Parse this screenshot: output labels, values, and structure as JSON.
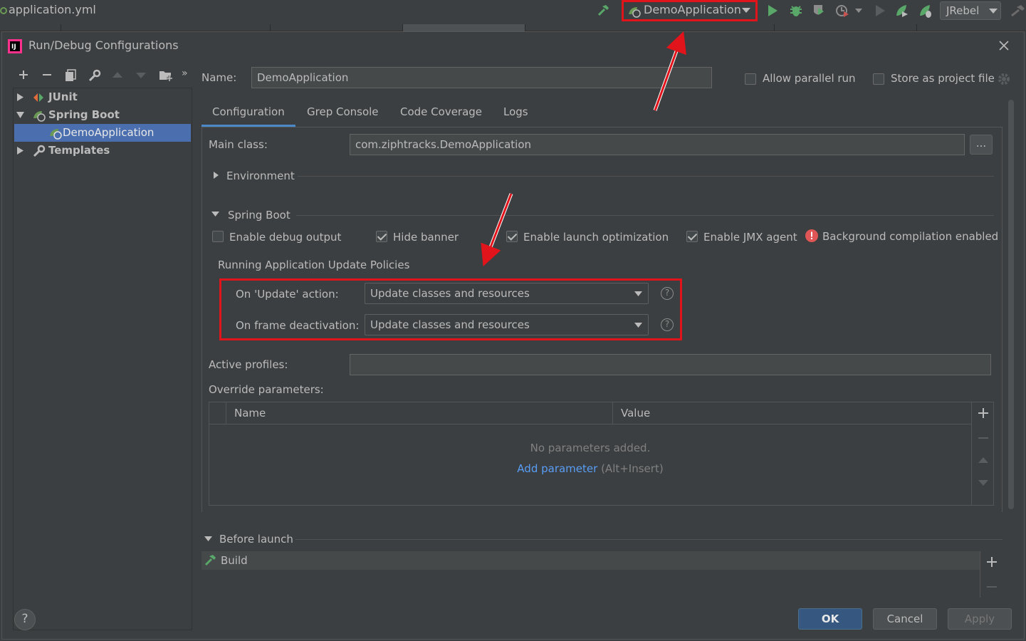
{
  "ide": {
    "file_name": "application.yml",
    "run_config": "DemoApplication",
    "jrebel": "JRebel"
  },
  "dialog": {
    "title": "Run/Debug Configurations",
    "tree": {
      "junit": "JUnit",
      "spring_boot": "Spring Boot",
      "demo_app": "DemoApplication",
      "templates": "Templates"
    },
    "name_label": "Name:",
    "name_value": "DemoApplication",
    "allow_parallel": "Allow parallel run",
    "store_project": "Store as project file",
    "tabs": [
      "Configuration",
      "Grep Console",
      "Code Coverage",
      "Logs"
    ],
    "main_class_label": "Main class:",
    "main_class_value": "com.ziphtracks.DemoApplication",
    "browse_label": "...",
    "environment": "Environment",
    "spring_boot_section": "Spring Boot",
    "checkboxes": {
      "debug_output": "Enable debug output",
      "hide_banner": "Hide banner",
      "launch_opt": "Enable launch optimization",
      "jmx": "Enable JMX agent"
    },
    "bg_compilation": "Background compilation enabled",
    "policies_title": "Running Application Update Policies",
    "on_update_label": "On 'Update' action:",
    "on_update_value": "Update classes and resources",
    "on_frame_label": "On frame deactivation:",
    "on_frame_value": "Update classes and resources",
    "help_glyph": "?",
    "active_profiles_label": "Active profiles:",
    "override_label": "Override parameters:",
    "table_name_header": "Name",
    "table_value_header": "Value",
    "no_params": "No parameters added.",
    "add_param": "Add parameter",
    "add_param_shortcut": "(Alt+Insert)",
    "before_launch": "Before launch",
    "build": "Build",
    "ok": "OK",
    "cancel": "Cancel",
    "apply": "Apply"
  },
  "colors": {
    "accent": "#4b6eaf",
    "highlight_red": "#e0141a",
    "link": "#589df6",
    "spring_green": "#6a9955"
  }
}
